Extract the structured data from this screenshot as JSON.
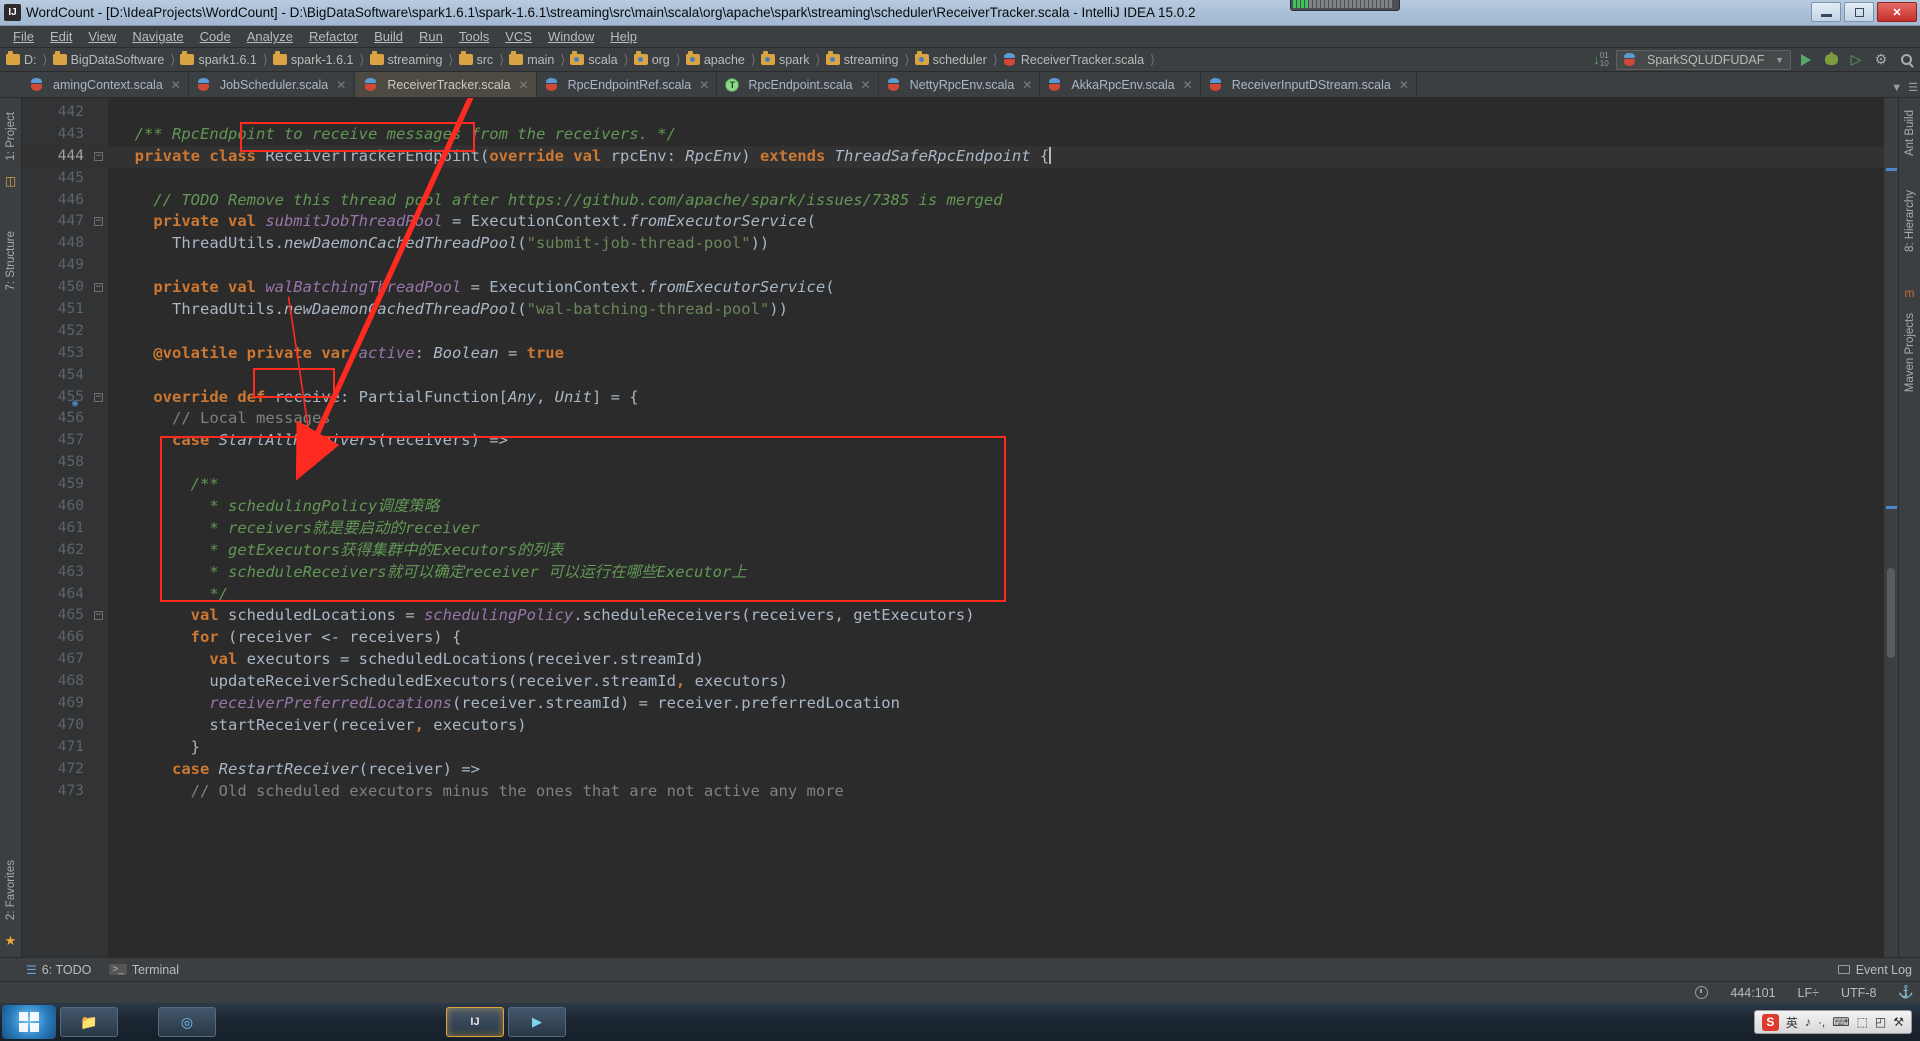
{
  "window": {
    "title": "WordCount - [D:\\IdeaProjects\\WordCount] - D:\\BigDataSoftware\\spark1.6.1\\spark-1.6.1\\streaming\\src\\main\\scala\\org\\apache\\spark\\streaming\\scheduler\\ReceiverTracker.scala - IntelliJ IDEA 15.0.2",
    "app_icon": "IJ",
    "minimize_label": "Minimize",
    "maximize_label": "Maximize",
    "close_label": "✕"
  },
  "menubar": {
    "items": [
      {
        "label": "File",
        "mnemonic": "F"
      },
      {
        "label": "Edit",
        "mnemonic": "E"
      },
      {
        "label": "View",
        "mnemonic": "V"
      },
      {
        "label": "Navigate",
        "mnemonic": "N"
      },
      {
        "label": "Code",
        "mnemonic": "C"
      },
      {
        "label": "Analyze",
        "mnemonic": "z"
      },
      {
        "label": "Refactor",
        "mnemonic": "R"
      },
      {
        "label": "Build",
        "mnemonic": "B"
      },
      {
        "label": "Run",
        "mnemonic": "u"
      },
      {
        "label": "Tools",
        "mnemonic": "T"
      },
      {
        "label": "VCS",
        "mnemonic": "V"
      },
      {
        "label": "Window",
        "mnemonic": "W"
      },
      {
        "label": "Help",
        "mnemonic": "H"
      }
    ]
  },
  "navbar": {
    "crumbs": [
      {
        "label": "D:",
        "icon": "folder-icon"
      },
      {
        "label": "BigDataSoftware",
        "icon": "folder-icon"
      },
      {
        "label": "spark1.6.1",
        "icon": "folder-icon"
      },
      {
        "label": "spark-1.6.1",
        "icon": "folder-icon"
      },
      {
        "label": "streaming",
        "icon": "folder-icon"
      },
      {
        "label": "src",
        "icon": "folder-icon"
      },
      {
        "label": "main",
        "icon": "folder-icon"
      },
      {
        "label": "scala",
        "icon": "source-folder-icon"
      },
      {
        "label": "org",
        "icon": "folder-icon"
      },
      {
        "label": "apache",
        "icon": "folder-icon"
      },
      {
        "label": "spark",
        "icon": "folder-icon"
      },
      {
        "label": "streaming",
        "icon": "folder-icon"
      },
      {
        "label": "scheduler",
        "icon": "folder-icon"
      },
      {
        "label": "ReceiverTracker.scala",
        "icon": "scala-file-icon"
      }
    ],
    "run_configuration": "SparkSQLUDFUDAF",
    "run_label": "Run",
    "debug_label": "Debug",
    "coverage_label": "Run with Coverage",
    "sync_label": "Update project",
    "settings_label": "Settings",
    "search_label": "Search Everywhere"
  },
  "tabs": [
    {
      "label": "amingContext.scala",
      "icon": "scala-file-icon",
      "active": false,
      "truncated": true
    },
    {
      "label": "JobScheduler.scala",
      "icon": "scala-file-icon",
      "active": false
    },
    {
      "label": "ReceiverTracker.scala",
      "icon": "scala-file-icon",
      "active": true,
      "highlighted": true
    },
    {
      "label": "RpcEndpointRef.scala",
      "icon": "scala-file-icon",
      "active": false
    },
    {
      "label": "RpcEndpoint.scala",
      "icon": "scala-trait-icon",
      "active": false
    },
    {
      "label": "NettyRpcEnv.scala",
      "icon": "scala-file-icon",
      "active": false
    },
    {
      "label": "AkkaRpcEnv.scala",
      "icon": "scala-file-icon",
      "active": false
    },
    {
      "label": "ReceiverInputDStream.scala",
      "icon": "scala-file-icon",
      "active": false
    }
  ],
  "left_rail": [
    {
      "label": "1: Project",
      "icon": "project-icon"
    },
    {
      "label": "7: Structure",
      "icon": "structure-icon"
    },
    {
      "label": "2: Favorites",
      "icon": "favorites-icon"
    }
  ],
  "right_rail": [
    {
      "label": "Ant Build",
      "icon": "ant-icon"
    },
    {
      "label": "8: Hierarchy",
      "icon": "hierarchy-icon"
    },
    {
      "label": "Maven Projects",
      "icon": "maven-icon"
    }
  ],
  "editor": {
    "first_line": 442,
    "lines": [
      {
        "n": 442,
        "fold": false,
        "segments": []
      },
      {
        "n": 443,
        "fold": false,
        "segments": [
          {
            "t": "  ",
            "c": "plain"
          },
          {
            "t": "/** RpcEndpoint to receive messages from the receivers. */",
            "c": "cmt"
          }
        ]
      },
      {
        "n": 444,
        "fold": true,
        "current": true,
        "segments": [
          {
            "t": "  ",
            "c": "plain"
          },
          {
            "t": "private class ",
            "c": "kw"
          },
          {
            "t": "ReceiverTrackerEndpoint",
            "c": "plain"
          },
          {
            "t": "(",
            "c": "plain"
          },
          {
            "t": "override val ",
            "c": "kw"
          },
          {
            "t": "rpcEnv: ",
            "c": "plain"
          },
          {
            "t": "RpcEnv",
            "c": "typ"
          },
          {
            "t": ") ",
            "c": "plain"
          },
          {
            "t": "extends ",
            "c": "kw"
          },
          {
            "t": "ThreadSafeRpcEndpoint",
            "c": "typ"
          },
          {
            "t": " {",
            "c": "plain"
          }
        ]
      },
      {
        "n": 445,
        "fold": false,
        "segments": []
      },
      {
        "n": 446,
        "fold": false,
        "segments": [
          {
            "t": "    ",
            "c": "plain"
          },
          {
            "t": "// TODO Remove this thread pool after https://github.com/apache/spark/issues/7385 is merged",
            "c": "cmt"
          }
        ]
      },
      {
        "n": 447,
        "fold": true,
        "segments": [
          {
            "t": "    ",
            "c": "plain"
          },
          {
            "t": "private val ",
            "c": "kw"
          },
          {
            "t": "submitJobThreadPool",
            "c": "fld"
          },
          {
            "t": " = ExecutionContext.",
            "c": "plain"
          },
          {
            "t": "fromExecutorService",
            "c": "typ"
          },
          {
            "t": "(",
            "c": "plain"
          }
        ]
      },
      {
        "n": 448,
        "fold": false,
        "segments": [
          {
            "t": "      ThreadUtils.",
            "c": "plain"
          },
          {
            "t": "newDaemonCachedThreadPool",
            "c": "typ"
          },
          {
            "t": "(",
            "c": "plain"
          },
          {
            "t": "\"submit-job-thread-pool\"",
            "c": "str"
          },
          {
            "t": "))",
            "c": "plain"
          }
        ]
      },
      {
        "n": 449,
        "fold": false,
        "segments": []
      },
      {
        "n": 450,
        "fold": true,
        "segments": [
          {
            "t": "    ",
            "c": "plain"
          },
          {
            "t": "private val ",
            "c": "kw"
          },
          {
            "t": "walBatchingThreadPool",
            "c": "fld"
          },
          {
            "t": " = ExecutionContext.",
            "c": "plain"
          },
          {
            "t": "fromExecutorService",
            "c": "typ"
          },
          {
            "t": "(",
            "c": "plain"
          }
        ]
      },
      {
        "n": 451,
        "fold": false,
        "segments": [
          {
            "t": "      ThreadUtils.",
            "c": "plain"
          },
          {
            "t": "newDaemonCachedThreadPool",
            "c": "typ"
          },
          {
            "t": "(",
            "c": "plain"
          },
          {
            "t": "\"wal-batching-thread-pool\"",
            "c": "str"
          },
          {
            "t": "))",
            "c": "plain"
          }
        ]
      },
      {
        "n": 452,
        "fold": false,
        "segments": []
      },
      {
        "n": 453,
        "fold": false,
        "segments": [
          {
            "t": "    ",
            "c": "plain"
          },
          {
            "t": "@volatile private ",
            "c": "kw"
          },
          {
            "t": "var ",
            "c": "kw"
          },
          {
            "t": "active",
            "c": "fld"
          },
          {
            "t": ": ",
            "c": "plain"
          },
          {
            "t": "Boolean",
            "c": "typ"
          },
          {
            "t": " = ",
            "c": "plain"
          },
          {
            "t": "true",
            "c": "kw"
          }
        ]
      },
      {
        "n": 454,
        "fold": false,
        "segments": []
      },
      {
        "n": 455,
        "fold": true,
        "bookmark": true,
        "segments": [
          {
            "t": "    ",
            "c": "plain"
          },
          {
            "t": "override def ",
            "c": "kw"
          },
          {
            "t": "receive",
            "c": "plain"
          },
          {
            "t": ": PartialFunction[",
            "c": "plain"
          },
          {
            "t": "Any",
            "c": "typ"
          },
          {
            "t": ", ",
            "c": "plain"
          },
          {
            "t": "Unit",
            "c": "typ"
          },
          {
            "t": "] = {",
            "c": "plain"
          }
        ]
      },
      {
        "n": 456,
        "fold": false,
        "segments": [
          {
            "t": "      ",
            "c": "plain"
          },
          {
            "t": "// Local messages",
            "c": "cmt2"
          }
        ]
      },
      {
        "n": 457,
        "fold": false,
        "segments": [
          {
            "t": "      ",
            "c": "plain"
          },
          {
            "t": "case ",
            "c": "kw"
          },
          {
            "t": "StartAllReceivers",
            "c": "typ"
          },
          {
            "t": "(receivers) =>",
            "c": "plain"
          }
        ]
      },
      {
        "n": 458,
        "fold": false,
        "segments": []
      },
      {
        "n": 459,
        "fold": false,
        "segments": [
          {
            "t": "        ",
            "c": "plain"
          },
          {
            "t": "/**",
            "c": "cmt"
          }
        ]
      },
      {
        "n": 460,
        "fold": false,
        "segments": [
          {
            "t": "          ",
            "c": "plain"
          },
          {
            "t": "* schedulingPolicy调度策略",
            "c": "cmt"
          }
        ]
      },
      {
        "n": 461,
        "fold": false,
        "segments": [
          {
            "t": "          ",
            "c": "plain"
          },
          {
            "t": "* receivers就是要启动的receiver",
            "c": "cmt"
          }
        ]
      },
      {
        "n": 462,
        "fold": false,
        "segments": [
          {
            "t": "          ",
            "c": "plain"
          },
          {
            "t": "* getExecutors获得集群中的Executors的列表",
            "c": "cmt"
          }
        ]
      },
      {
        "n": 463,
        "fold": false,
        "segments": [
          {
            "t": "          ",
            "c": "plain"
          },
          {
            "t": "* scheduleReceivers就可以确定receiver 可以运行在哪些Executor上",
            "c": "cmt"
          }
        ]
      },
      {
        "n": 464,
        "fold": false,
        "segments": [
          {
            "t": "          ",
            "c": "plain"
          },
          {
            "t": "*/",
            "c": "cmt"
          }
        ]
      },
      {
        "n": 465,
        "fold": false,
        "segments": [
          {
            "t": "        ",
            "c": "plain"
          },
          {
            "t": "val ",
            "c": "kw"
          },
          {
            "t": "scheduledLocations = ",
            "c": "plain"
          },
          {
            "t": "schedulingPolicy",
            "c": "fld"
          },
          {
            "t": ".scheduleReceivers(receivers, getExecutors)",
            "c": "plain"
          }
        ]
      },
      {
        "n": 466,
        "fold": true,
        "segments": [
          {
            "t": "        ",
            "c": "plain"
          },
          {
            "t": "for ",
            "c": "kw"
          },
          {
            "t": "(receiver <- receivers) {",
            "c": "plain"
          }
        ]
      },
      {
        "n": 467,
        "fold": false,
        "segments": [
          {
            "t": "          ",
            "c": "plain"
          },
          {
            "t": "val ",
            "c": "kw"
          },
          {
            "t": "executors = scheduledLocations(receiver.streamId)",
            "c": "plain"
          }
        ]
      },
      {
        "n": 468,
        "fold": false,
        "segments": [
          {
            "t": "          updateReceiverScheduledExecutors(receiver.streamId",
            "c": "plain"
          },
          {
            "t": ", ",
            "c": "kw"
          },
          {
            "t": "executors)",
            "c": "plain"
          }
        ]
      },
      {
        "n": 469,
        "fold": false,
        "segments": [
          {
            "t": "          ",
            "c": "plain"
          },
          {
            "t": "receiverPreferredLocations",
            "c": "fld"
          },
          {
            "t": "(receiver.streamId) = receiver.preferredLocation",
            "c": "plain"
          }
        ]
      },
      {
        "n": 470,
        "fold": false,
        "segments": [
          {
            "t": "          startReceiver(receiver",
            "c": "plain"
          },
          {
            "t": ", ",
            "c": "kw"
          },
          {
            "t": "executors)",
            "c": "plain"
          }
        ]
      },
      {
        "n": 471,
        "fold": false,
        "segments": [
          {
            "t": "        }",
            "c": "plain"
          }
        ]
      },
      {
        "n": 472,
        "fold": false,
        "segments": [
          {
            "t": "      ",
            "c": "plain"
          },
          {
            "t": "case ",
            "c": "kw"
          },
          {
            "t": "RestartReceiver",
            "c": "typ"
          },
          {
            "t": "(receiver) =>",
            "c": "plain"
          }
        ]
      },
      {
        "n": 473,
        "fold": false,
        "segments": [
          {
            "t": "        ",
            "c": "plain"
          },
          {
            "t": "// Old scheduled executors minus the ones that are not active any more",
            "c": "cmt2"
          }
        ]
      }
    ],
    "annotations": {
      "color": "#ff2a20",
      "boxes": [
        {
          "name": "tab-highlight-box"
        },
        {
          "name": "class-name-highlight-box"
        },
        {
          "name": "receive-method-highlight-box"
        },
        {
          "name": "scheduling-comment-highlight-box"
        }
      ],
      "arrow_label": "arrow-from-tab-to-class"
    }
  },
  "bottombar": {
    "items": [
      {
        "label": "6: TODO",
        "icon": "todo-icon"
      },
      {
        "label": "Terminal",
        "icon": "terminal-icon"
      }
    ],
    "event_log": "Event Log"
  },
  "statusbar": {
    "caret_position": "444:101",
    "line_separator": "LF÷",
    "encoding": "UTF-8",
    "lock_label": "⚓"
  },
  "taskbar": {
    "start_label": "Start",
    "ime": {
      "logo": "S",
      "mode": "英",
      "items": [
        "♪",
        "·,",
        "⌨",
        "⬚",
        "◰",
        "⚒"
      ]
    },
    "apps": [
      {
        "name": "explorer-task"
      },
      {
        "name": "browser-task"
      },
      {
        "name": "idea-task"
      },
      {
        "name": "media-task"
      }
    ]
  },
  "colors": {
    "accent_red": "#ff2a20",
    "editor_bg": "#2b2b2b",
    "gutter_bg": "#313335",
    "chrome_bg": "#3c3f41",
    "keyword": "#cc7832",
    "comment": "#629755",
    "string": "#6a8759",
    "field": "#9876aa",
    "plain_text": "#a9b7c6"
  }
}
